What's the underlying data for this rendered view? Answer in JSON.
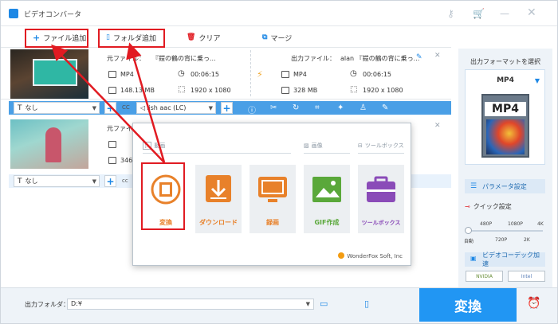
{
  "app": {
    "title": "ビデオコンバータ"
  },
  "toolbar": {
    "add_file": "ファイル追加",
    "add_folder": "フォルダ追加",
    "clear": "クリア",
    "merge": "マージ"
  },
  "files": [
    {
      "source_label": "元ファイル：",
      "source_name": "『鎧の鶴の背に乗っ...",
      "format": "MP4",
      "duration": "00:06:15",
      "size": "148.13 MB",
      "resolution": "1920 x 1080",
      "output_label": "出力ファイル：",
      "output_name": "alan 『鎧の鶴の背に乗っ...",
      "output_format": "MP4",
      "output_duration": "00:06:15",
      "output_size": "328 MB",
      "output_resolution": "1920 x 1080",
      "subtitle": "なし",
      "audio": "lish aac (LC)"
    },
    {
      "source_label": "元ファイル：",
      "size_partial": "346",
      "subtitle": "なし",
      "audio": "cc"
    }
  ],
  "popup": {
    "groups": [
      "動画",
      "画像",
      "ツールボックス"
    ],
    "tiles": [
      {
        "label": "変換",
        "color": "#e8812a"
      },
      {
        "label": "ダウンロード",
        "color": "#e8812a"
      },
      {
        "label": "録画",
        "color": "#e8812a"
      },
      {
        "label": "GIF作成",
        "color": "#5aa83a"
      },
      {
        "label": "ツールボックス",
        "color": "#8a4bb8"
      }
    ],
    "brand": "WonderFox Soft, Inc"
  },
  "right_panel": {
    "title": "出力フォーマットを選択",
    "format": "MP4",
    "format_badge": "MP4",
    "param": "パラメータ設定",
    "quick": "クイック設定",
    "ticks_top": [
      "480P",
      "1080P",
      "4K"
    ],
    "ticks_bottom": [
      "自動",
      "720P",
      "2K"
    ],
    "hw": "ビデオコーデック加速",
    "chips": [
      "NVIDIA",
      "Intel"
    ]
  },
  "bottom": {
    "output_folder_label": "出力フォルダ：",
    "output_folder_value": "D:¥",
    "convert": "変換"
  },
  "colors": {
    "accent": "#2196f3",
    "highlight": "#e11b22"
  }
}
